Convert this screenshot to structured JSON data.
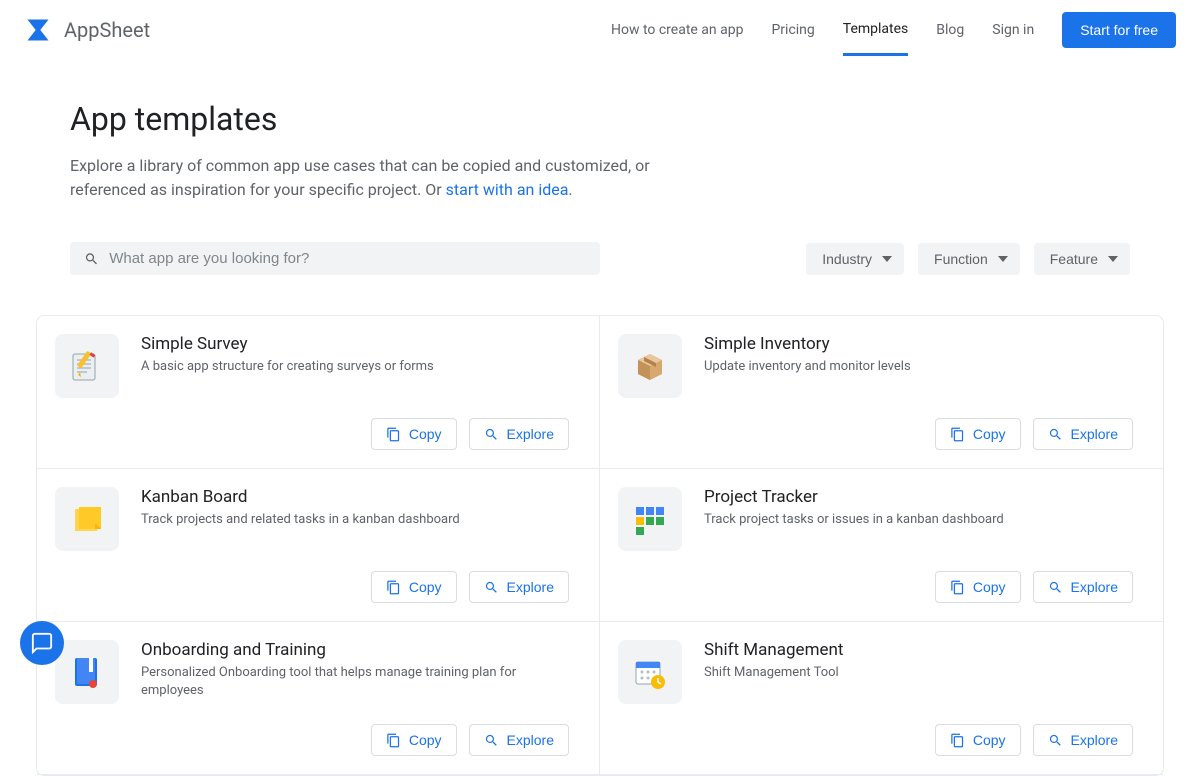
{
  "brand": "AppSheet",
  "nav": {
    "items": [
      "How to create an app",
      "Pricing",
      "Templates",
      "Blog",
      "Sign in"
    ],
    "active_index": 2,
    "cta": "Start for free"
  },
  "page": {
    "title": "App templates",
    "desc_pre": "Explore a library of common app use cases that can be copied and customized, or referenced as inspiration for your specific project. Or ",
    "desc_link": "start with an idea",
    "desc_post": "."
  },
  "search": {
    "placeholder": "What app are you looking for?"
  },
  "filters": [
    "Industry",
    "Function",
    "Feature"
  ],
  "actions": {
    "copy": "Copy",
    "explore": "Explore"
  },
  "templates": [
    {
      "title": "Simple Survey",
      "desc": "A basic app structure for creating surveys or forms",
      "icon": "pencil-paper"
    },
    {
      "title": "Simple Inventory",
      "desc": "Update inventory and monitor levels",
      "icon": "box"
    },
    {
      "title": "Kanban Board",
      "desc": "Track projects and related tasks in a kanban dashboard",
      "icon": "sticky-notes"
    },
    {
      "title": "Project Tracker",
      "desc": "Track project tasks or issues in a kanban dashboard",
      "icon": "kanban-grid"
    },
    {
      "title": "Onboarding and Training",
      "desc": "Personalized Onboarding tool that helps manage training plan for employees",
      "icon": "book-bookmark"
    },
    {
      "title": "Shift Management",
      "desc": "Shift Management Tool",
      "icon": "calendar-clock"
    }
  ]
}
